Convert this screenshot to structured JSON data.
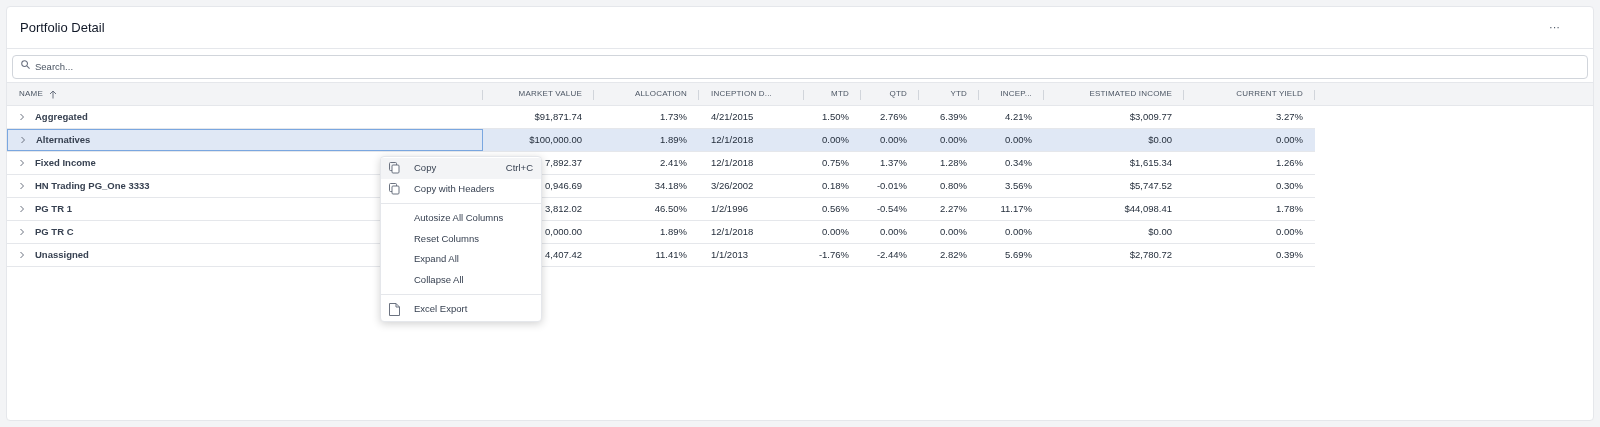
{
  "panel": {
    "title": "Portfolio Detail",
    "menu_icon": "···"
  },
  "search": {
    "placeholder": "Search..."
  },
  "table": {
    "columns": [
      {
        "label": "NAME",
        "sort_ascending": true
      },
      {
        "label": "MARKET VALUE"
      },
      {
        "label": "ALLOCATION"
      },
      {
        "label": "INCEPTION D..."
      },
      {
        "label": "MTD"
      },
      {
        "label": "QTD"
      },
      {
        "label": "YTD"
      },
      {
        "label": "INCEP..."
      },
      {
        "label": "ESTIMATED INCOME"
      },
      {
        "label": "CURRENT YIELD"
      }
    ],
    "rows": [
      {
        "selected": false,
        "expanded": false,
        "cells": [
          "Aggregated",
          "$91,871.74",
          "1.73%",
          "4/21/2015",
          "1.50%",
          "2.76%",
          "6.39%",
          "4.21%",
          "$3,009.77",
          "3.27%"
        ]
      },
      {
        "selected": true,
        "expanded": false,
        "cells": [
          "Alternatives",
          "$100,000.00",
          "1.89%",
          "12/1/2018",
          "0.00%",
          "0.00%",
          "0.00%",
          "0.00%",
          "$0.00",
          "0.00%"
        ]
      },
      {
        "selected": false,
        "expanded": false,
        "cells": [
          "Fixed Income",
          "7,892.37",
          "2.41%",
          "12/1/2018",
          "0.75%",
          "1.37%",
          "1.28%",
          "0.34%",
          "$1,615.34",
          "1.26%"
        ]
      },
      {
        "selected": false,
        "expanded": false,
        "cells": [
          "HN Trading PG_One 3333",
          "0,946.69",
          "34.18%",
          "3/26/2002",
          "0.18%",
          "-0.01%",
          "0.80%",
          "3.56%",
          "$5,747.52",
          "0.30%"
        ]
      },
      {
        "selected": false,
        "expanded": false,
        "cells": [
          "PG TR 1",
          "3,812.02",
          "46.50%",
          "1/2/1996",
          "0.56%",
          "-0.54%",
          "2.27%",
          "11.17%",
          "$44,098.41",
          "1.78%"
        ]
      },
      {
        "selected": false,
        "expanded": false,
        "cells": [
          "PG TR C",
          "0,000.00",
          "1.89%",
          "12/1/2018",
          "0.00%",
          "0.00%",
          "0.00%",
          "0.00%",
          "$0.00",
          "0.00%"
        ]
      },
      {
        "selected": false,
        "expanded": false,
        "cells": [
          "Unassigned",
          "4,407.42",
          "11.41%",
          "1/1/2013",
          "-1.76%",
          "-2.44%",
          "2.82%",
          "5.69%",
          "$2,780.72",
          "0.39%"
        ]
      }
    ]
  },
  "context_menu": [
    {
      "kind": "copy",
      "label": "Copy",
      "shortcut": "Ctrl+C",
      "selected": true
    },
    {
      "kind": "copy",
      "label": "Copy with Headers",
      "selected": false
    },
    {
      "kind": "separator"
    },
    {
      "kind": "plain",
      "label": "Autosize All Columns",
      "selected": false
    },
    {
      "kind": "plain",
      "label": "Reset Columns",
      "selected": false
    },
    {
      "kind": "plain",
      "label": "Expand All",
      "selected": false
    },
    {
      "kind": "plain",
      "label": "Collapse All",
      "selected": false
    },
    {
      "kind": "separator"
    },
    {
      "kind": "export",
      "label": "Excel Export",
      "selected": false
    }
  ]
}
